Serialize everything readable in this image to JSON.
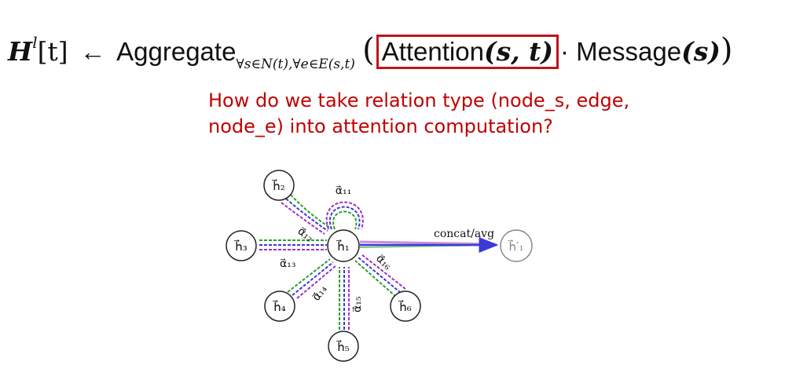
{
  "formula": {
    "lhs_H": "H",
    "lhs_sup": "l",
    "lhs_index": "[t]",
    "arrow": "←",
    "aggregate": "Aggregate",
    "aggregate_sub": "∀s∈N(t),∀e∈E(s,t)",
    "open_paren": "(",
    "attention": "Attention",
    "attention_args": "(s, t)",
    "dot": "·",
    "message": "Message",
    "message_args": "(s)",
    "close_paren": ")"
  },
  "question": {
    "line1": "How do we take relation type (node_s, edge,",
    "line2": "node_e) into attention computation?"
  },
  "diagram": {
    "nodes": {
      "center": "h⃗₁",
      "h2": "h⃗₂",
      "h3": "h⃗₃",
      "h4": "h⃗₄",
      "h5": "h⃗₅",
      "h6": "h⃗₆",
      "output": "h⃗′₁"
    },
    "edge_labels": {
      "a11": "α⃗₁₁",
      "a12": "α⃗₁₂",
      "a13": "α⃗₁₃",
      "a14": "α⃗₁₄",
      "a15": "α⃗₁₅",
      "a16": "α⃗₁₆"
    },
    "output_label": "concat/avg",
    "colors": {
      "head1": "#2aa02a",
      "head2": "#3a3ad8",
      "head3": "#a030c8",
      "highlight_box": "#c0141c",
      "question_text": "#c00000"
    }
  }
}
